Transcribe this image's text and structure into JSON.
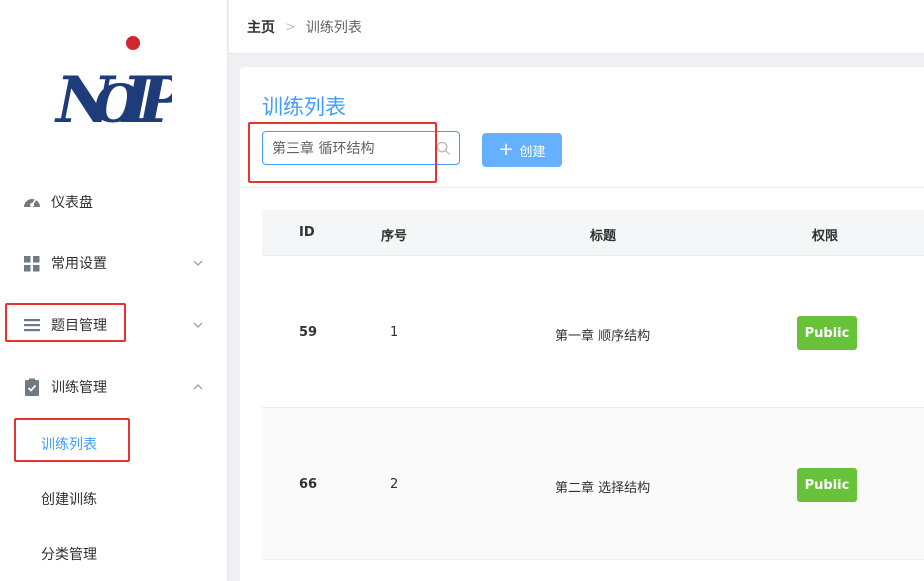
{
  "sidebar": {
    "logo_text": "NOIP",
    "items": [
      {
        "label": "仪表盘",
        "icon": "dashboard-icon"
      },
      {
        "label": "常用设置",
        "icon": "grid-icon"
      },
      {
        "label": "题目管理",
        "icon": "menu-lines-icon"
      },
      {
        "label": "训练管理",
        "icon": "clipboard-check-icon"
      }
    ],
    "sub_items": [
      {
        "label": "训练列表",
        "active": true
      },
      {
        "label": "创建训练"
      },
      {
        "label": "分类管理"
      }
    ]
  },
  "breadcrumb": {
    "home": "主页",
    "separator": ">",
    "current": "训练列表"
  },
  "main": {
    "title": "训练列表",
    "search_value": "第三章 循环结构",
    "create_label": "创建",
    "table": {
      "headers": {
        "id": "ID",
        "order": "序号",
        "title": "标题",
        "permission": "权限"
      },
      "rows": [
        {
          "id": "59",
          "order": "1",
          "title": "第一章 顺序结构",
          "permission": "Public"
        },
        {
          "id": "66",
          "order": "2",
          "title": "第二章 选择结构",
          "permission": "Public"
        }
      ]
    }
  },
  "colors": {
    "accent": "#409eff",
    "public_badge": "#67c23a",
    "highlight_box": "#e8322e"
  }
}
